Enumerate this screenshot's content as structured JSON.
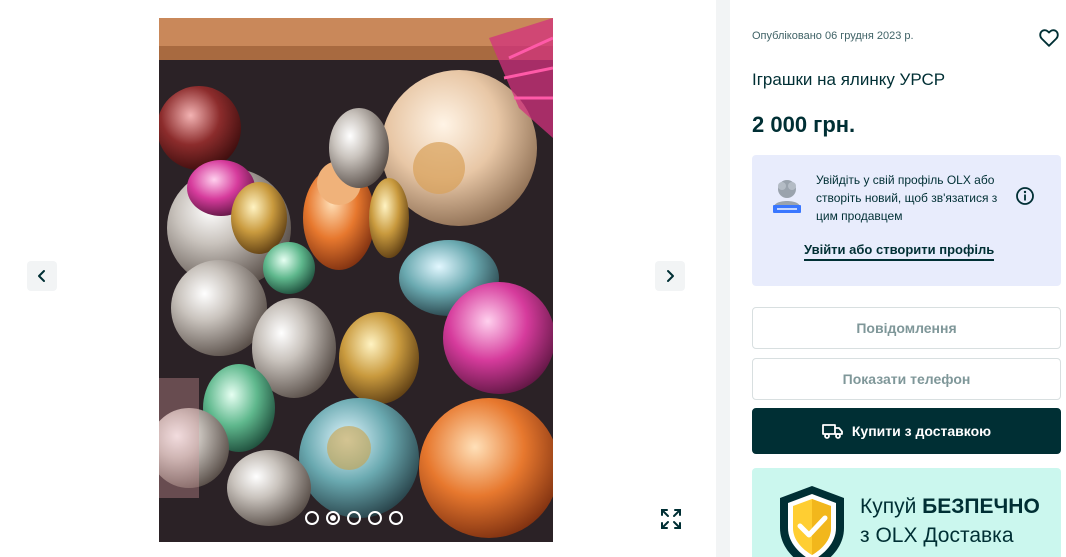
{
  "gallery": {
    "image_count": 5,
    "active_index": 1
  },
  "listing": {
    "published": "Опубліковано 06 грудня 2023 р.",
    "title": "Іграшки на ялинку УРСР",
    "price": "2 000 грн."
  },
  "login_prompt": {
    "text": "Увійдіть у свій профіль OLX або створіть новий, щоб зв'язатися з цим продавцем",
    "link": "Увійти або створити профіль"
  },
  "actions": {
    "message": "Повідомлення",
    "show_phone": "Показати телефон",
    "buy_delivery": "Купити з доставкою"
  },
  "promo": {
    "line1_prefix": "Купуй ",
    "line1_bold": "БЕЗПЕЧНО",
    "line2": "з OLX Доставка"
  },
  "colors": {
    "brand_dark": "#002f34",
    "login_bg": "#e8ecfc",
    "promo_bg": "#cbf7ee",
    "shield_yellow": "#ffce32"
  }
}
